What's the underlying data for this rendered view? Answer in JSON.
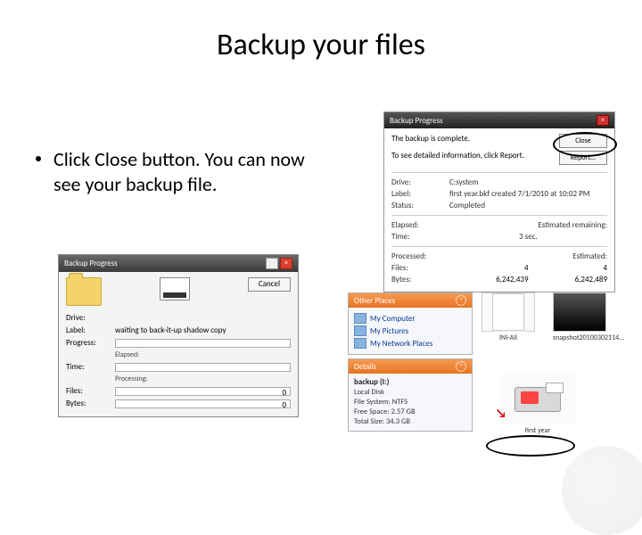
{
  "slide": {
    "title": "Backup your files",
    "bullet": "Click Close button. You can now see your backup file."
  },
  "dlg1": {
    "title": "Backup Progress",
    "complete_msg": "The backup is complete.",
    "detail_msg": "To see detailed information, click Report.",
    "close_btn": "Close",
    "report_btn": "Report...",
    "rows": {
      "drive_lbl": "Drive:",
      "drive_val": "C:system",
      "label_lbl": "Label:",
      "label_val": "first year.bkf created 7/1/2010 at 10:02 PM",
      "status_lbl": "Status:",
      "status_val": "Completed"
    },
    "cols": {
      "elapsed": "Elapsed:",
      "remaining": "Estimated remaining:"
    },
    "time_lbl": "Time:",
    "time_val": "3 sec.",
    "proc_lbl": "Processed:",
    "est_lbl": "Estimated:",
    "files_lbl": "Files:",
    "files_proc": "4",
    "files_est": "4",
    "bytes_lbl": "Bytes:",
    "bytes_proc": "6,242,439",
    "bytes_est": "6,242,489"
  },
  "dlg2": {
    "title": "Backup Progress",
    "cancel_btn": "Cancel",
    "rows": {
      "drive_lbl": "Drive:",
      "label_lbl": "Label:",
      "label_val": "waiting to back-it-up shadow copy",
      "progress_lbl": "Progress:",
      "elapsed_lbl": "Elapsed:",
      "time_lbl": "Time:",
      "processing_lbl": "Processing:",
      "files_lbl": "Files:",
      "files_val": "0",
      "bytes_lbl": "Bytes:",
      "bytes_val": "0"
    }
  },
  "sidebar": {
    "other_places": {
      "heading": "Other Places",
      "items": [
        "My Computer",
        "My Pictures",
        "My Network Places"
      ]
    },
    "details": {
      "heading": "Details",
      "title": "backup (I:)",
      "lines": [
        "Local Disk",
        "File System: NTFS",
        "Free Space: 2.57 GB",
        "Total Size: 34.3 GB"
      ]
    }
  },
  "thumbs": {
    "t1_label": "INI-All",
    "t2_label": "snapshot20100302114...",
    "t3_label": "first year"
  }
}
